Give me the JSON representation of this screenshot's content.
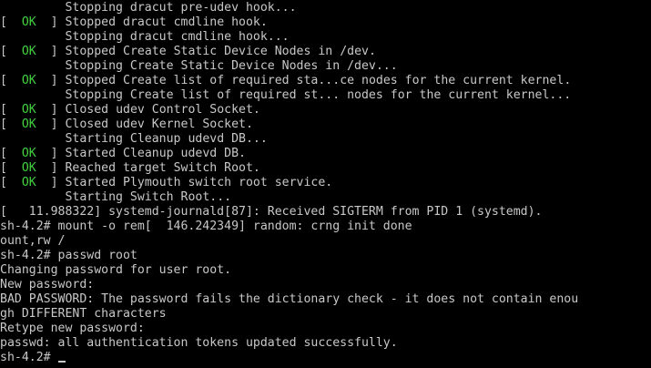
{
  "colors": {
    "background": "#000000",
    "text": "#c8c8c8",
    "ok": "#3fd13f"
  },
  "status": {
    "open": "[",
    "ok": "  OK  ",
    "close": "]"
  },
  "lines": [
    {
      "prefix": "         ",
      "text": "Stopping dracut pre-udev hook..."
    },
    {
      "status": true,
      "text": " Stopped dracut cmdline hook."
    },
    {
      "prefix": "         ",
      "text": "Stopping dracut cmdline hook..."
    },
    {
      "status": true,
      "text": " Stopped Create Static Device Nodes in /dev."
    },
    {
      "prefix": "         ",
      "text": "Stopping Create Static Device Nodes in /dev..."
    },
    {
      "status": true,
      "text": " Stopped Create list of required sta...ce nodes for the current kernel."
    },
    {
      "prefix": "         ",
      "text": "Stopping Create list of required st... nodes for the current kernel..."
    },
    {
      "status": true,
      "text": " Closed udev Control Socket."
    },
    {
      "status": true,
      "text": " Closed udev Kernel Socket."
    },
    {
      "prefix": "         ",
      "text": "Starting Cleanup udevd DB..."
    },
    {
      "status": true,
      "text": " Started Cleanup udevd DB."
    },
    {
      "status": true,
      "text": " Reached target Switch Root."
    },
    {
      "status": true,
      "text": " Started Plymouth switch root service."
    },
    {
      "prefix": "         ",
      "text": "Starting Switch Root..."
    },
    {
      "prefix": "",
      "text": "[   11.988322] systemd-journald[87]: Received SIGTERM from PID 1 (systemd)."
    },
    {
      "prefix": "",
      "text": "sh-4.2# mount -o rem[  146.242349] random: crng init done"
    },
    {
      "prefix": "",
      "text": "ount,rw /"
    },
    {
      "prefix": "",
      "text": "sh-4.2# passwd root"
    },
    {
      "prefix": "",
      "text": "Changing password for user root."
    },
    {
      "prefix": "",
      "text": "New password:"
    },
    {
      "prefix": "",
      "text": "BAD PASSWORD: The password fails the dictionary check - it does not contain enou"
    },
    {
      "prefix": "",
      "text": "gh DIFFERENT characters"
    },
    {
      "prefix": "",
      "text": "Retype new password:"
    },
    {
      "prefix": "",
      "text": "passwd: all authentication tokens updated successfully."
    },
    {
      "prefix": "",
      "text": "sh-4.2# ",
      "cursor": true
    }
  ]
}
